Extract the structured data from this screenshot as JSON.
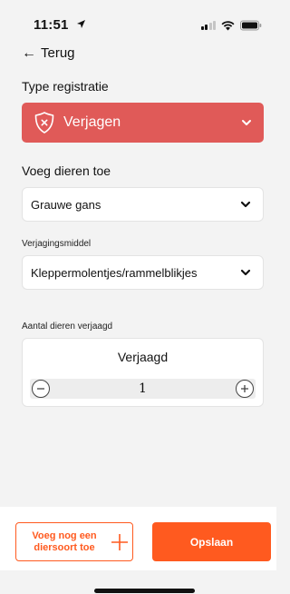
{
  "status_bar": {
    "time": "11:51"
  },
  "header": {
    "back_label": "Terug"
  },
  "registration": {
    "section_label": "Type registratie",
    "type_value": "Verjagen",
    "type_color": "#e05a58"
  },
  "animals": {
    "section_label": "Voeg dieren toe",
    "species_value": "Grauwe gans"
  },
  "method": {
    "section_label": "Verjagingsmiddel",
    "value": "Kleppermolentjes/rammelblikjes"
  },
  "counter": {
    "section_label": "Aantal dieren verjaagd",
    "title": "Verjaagd",
    "value": "1"
  },
  "actions": {
    "add_species_label": "Voeg nog een diersoort toe",
    "save_label": "Opslaan",
    "accent_color": "#ff5a1f"
  }
}
